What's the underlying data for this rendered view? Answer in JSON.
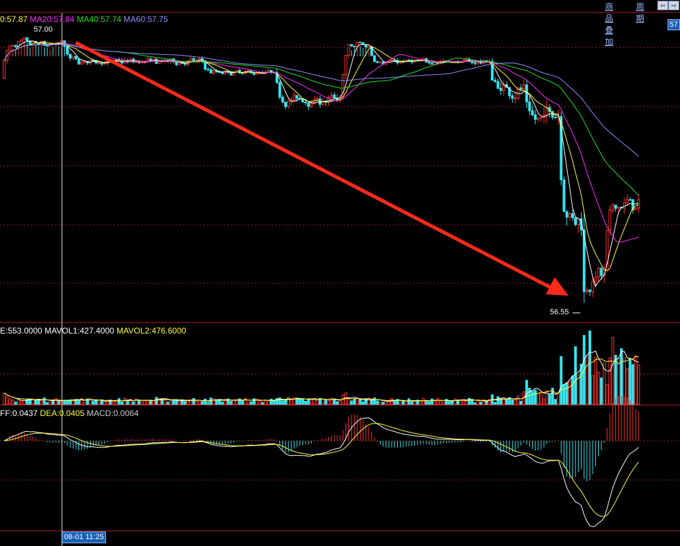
{
  "toolbar": {
    "overlay_label": "商品叠加",
    "period_label": "周期",
    "price_tag": "57"
  },
  "main_legend": [
    {
      "text": "0:57.87",
      "color": "#ffffff"
    },
    {
      "text": "MA20:57.84",
      "color": "#ff2cff"
    },
    {
      "text": "MA40:57.74",
      "color": "#22e022"
    },
    {
      "text": "MA60:57.75",
      "color": "#8f8fff"
    }
  ],
  "volume_legend": [
    {
      "text": "E:553.0000",
      "color": "#ffffff"
    },
    {
      "text": "MAVOL1:427.4000",
      "color": "#ffffff"
    },
    {
      "text": "MAVOL2:476.6000",
      "color": "#ffff33"
    }
  ],
  "macd_legend": [
    {
      "text": "FF:0.0437",
      "color": "#ffffff"
    },
    {
      "text": "DEA:0.0405",
      "color": "#ffff33"
    },
    {
      "text": "MACD:0.0064",
      "color": "#cccccc"
    }
  ],
  "annotations": {
    "high_label": "57.00",
    "low_label": "56.55",
    "crosshair_time": "08-01 11:25"
  },
  "colors": {
    "up": "#ff3030",
    "down": "#33e6f0",
    "grid": "#8a1f1f",
    "arrow": "#ff2a1a",
    "ma5": "#ffffff",
    "ma10": "#ffff33",
    "ma20": "#ff2cff",
    "ma40": "#22e022",
    "ma60": "#8f8fff"
  },
  "chart_data": [
    {
      "type": "candlestick",
      "title": "",
      "xlabel": "",
      "ylabel": "",
      "ylim": [
        56.53,
        57.05
      ],
      "segments": [
        {
          "from": 0,
          "level": 57.02,
          "noise": 0.02
        },
        {
          "from": 22,
          "level": 56.99,
          "noise": 0.012
        },
        {
          "from": 70,
          "level": 56.97,
          "noise": 0.01
        },
        {
          "from": 95,
          "level": 56.92,
          "noise": 0.02
        },
        {
          "from": 118,
          "level": 57.02,
          "noise": 0.025
        },
        {
          "from": 128,
          "level": 56.99,
          "noise": 0.01
        },
        {
          "from": 160,
          "level": 56.99,
          "noise": 0.012
        },
        {
          "from": 170,
          "level": 56.94,
          "noise": 0.03
        },
        {
          "from": 182,
          "level": 56.88,
          "noise": 0.03
        },
        {
          "from": 188,
          "level": 56.9,
          "noise": 0.04
        },
        {
          "from": 194,
          "level": 56.7,
          "noise": 0.04
        },
        {
          "from": 203,
          "level": 56.6,
          "noise": 0.04
        },
        {
          "from": 210,
          "level": 56.73,
          "noise": 0.03
        }
      ],
      "bar_count": 222,
      "high": 57.0,
      "low": 56.55
    },
    {
      "type": "bar",
      "name": "volume",
      "ylim": [
        0,
        1100
      ],
      "volume_now": 553.0,
      "mavol1": 427.4,
      "mavol2": 476.6
    },
    {
      "type": "bar",
      "name": "macd",
      "dif": 0.0437,
      "dea": 0.0405,
      "macd": 0.0064
    }
  ]
}
